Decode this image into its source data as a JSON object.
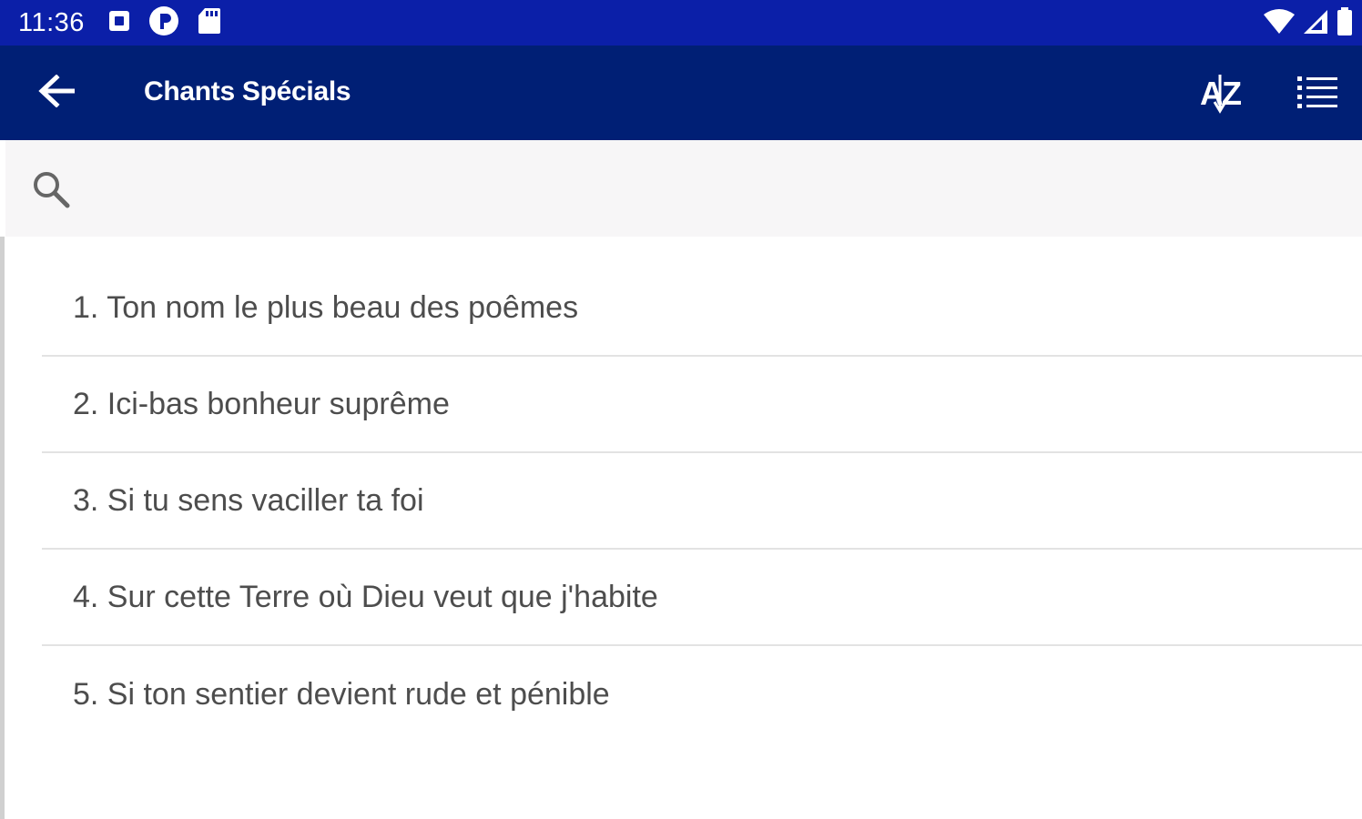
{
  "status_bar": {
    "time": "11:36",
    "left_icons": [
      "notification-icon",
      "data-saver-icon",
      "sd-card-icon"
    ],
    "right_icons": [
      "wifi-icon",
      "signal-icon",
      "battery-icon"
    ],
    "color": "#0b1fa8"
  },
  "app_bar": {
    "title": "Chants Spécials",
    "sort_label": "AZ",
    "color": "#001f75"
  },
  "search": {
    "placeholder": "",
    "value": ""
  },
  "songs": [
    "1. Ton nom le plus beau des poêmes",
    "2. Ici-bas bonheur suprême",
    "3. Si tu sens vaciller ta foi",
    "4. Sur cette Terre où Dieu veut que j'habite",
    "5. Si ton sentier devient rude et pénible"
  ]
}
